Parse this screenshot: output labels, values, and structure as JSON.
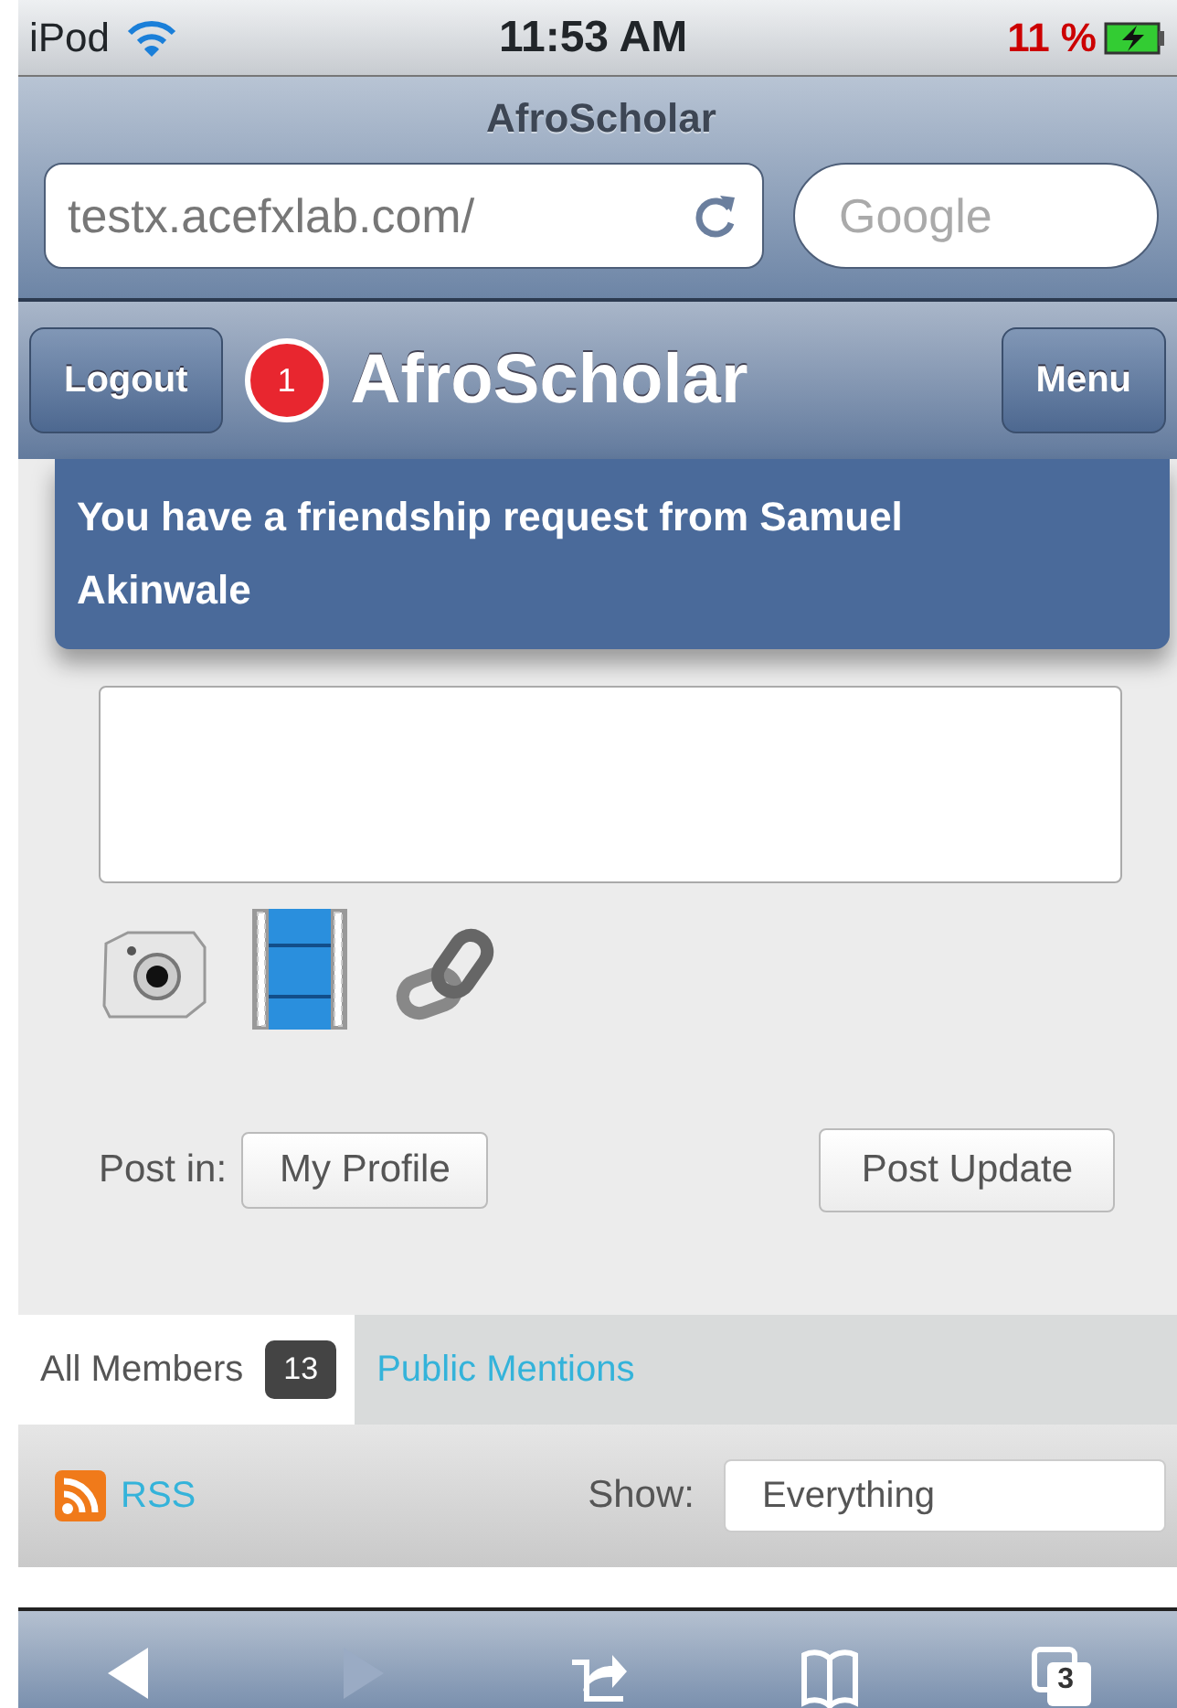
{
  "status_bar": {
    "device": "iPod",
    "time": "11:53 AM",
    "battery": "11 %"
  },
  "browser": {
    "title": "AfroScholar",
    "url": "testx.acefxlab.com/",
    "search_placeholder": "Google"
  },
  "header": {
    "logout": "Logout",
    "notification_count": "1",
    "title": "AfroScholar",
    "menu": "Menu"
  },
  "notification": {
    "text": "You have a friendship request from Samuel Akinwale"
  },
  "post_form": {
    "post_in_label": "Post in:",
    "post_in_value": "My Profile",
    "submit": "Post Update"
  },
  "tabs": [
    {
      "label": "All Members",
      "count": "13",
      "selected": true
    },
    {
      "label": "Public Mentions",
      "selected": false
    }
  ],
  "filter": {
    "rss": "RSS",
    "show_label": "Show:",
    "show_value": "Everything"
  },
  "toolbar": [
    {
      "kind": "back",
      "disabled": false
    },
    {
      "kind": "forward",
      "disabled": true
    },
    {
      "kind": "share",
      "disabled": false
    },
    {
      "kind": "bookmarks",
      "disabled": false
    },
    {
      "kind": "pages",
      "count": "3",
      "disabled": false
    }
  ]
}
